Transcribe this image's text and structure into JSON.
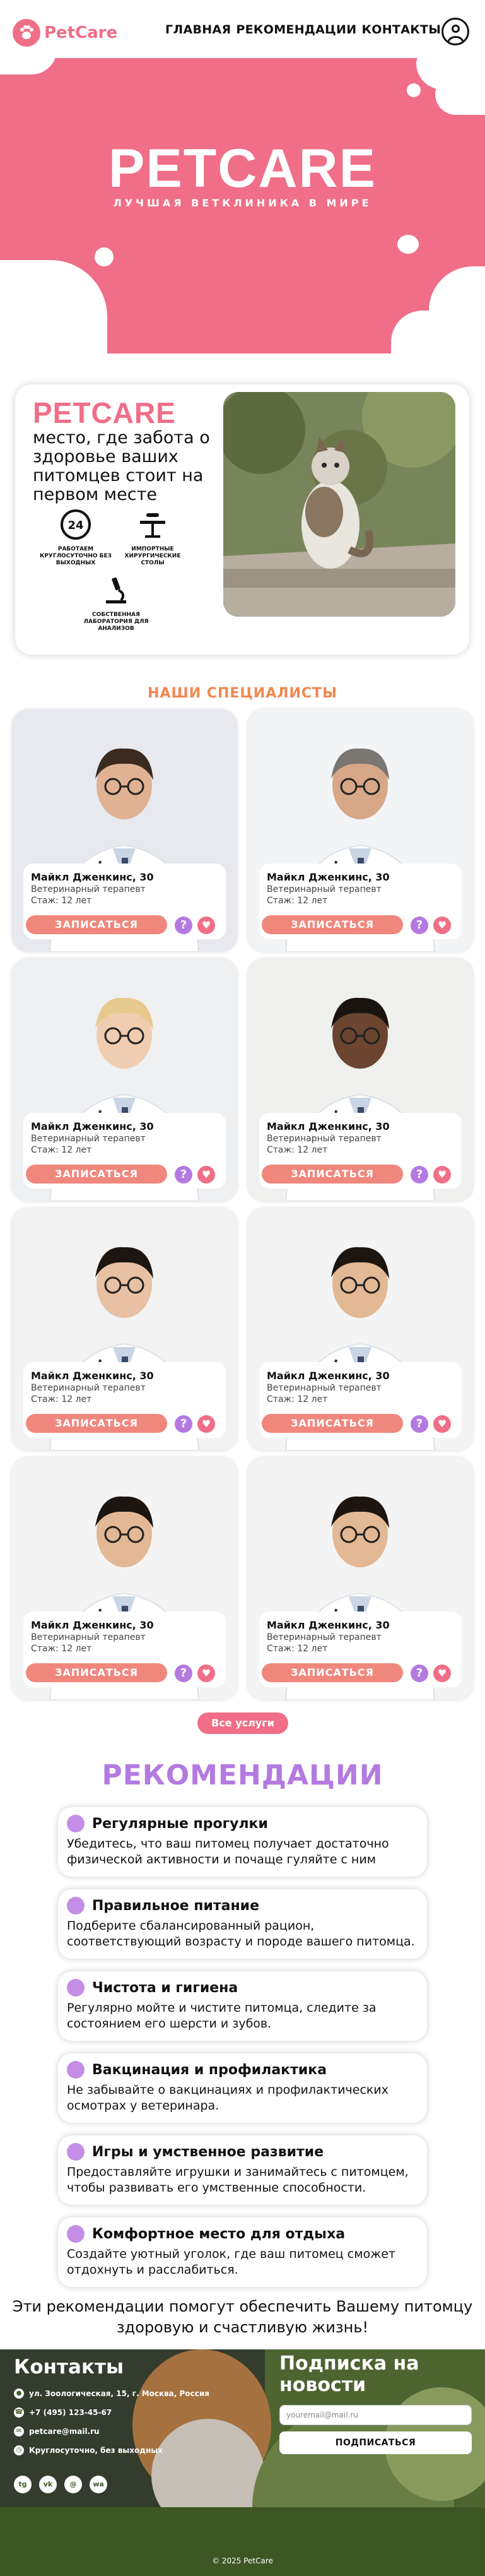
{
  "header": {
    "logo_text": "PetCare",
    "nav": [
      "ГЛАВНАЯ",
      "РЕКОМЕНДАЦИИ",
      "КОНТАКТЫ"
    ]
  },
  "hero": {
    "title": "PETCARE",
    "subtitle": "ЛУЧШАЯ ВЕТКЛИНИКА В МИРЕ"
  },
  "about": {
    "brand": "PETCARE",
    "text": "место, где забота о здоровье ваших питомцев стоит на первом месте",
    "features": [
      {
        "icon": "clock-24-icon",
        "label": "РАБОТАЕМ КРУГЛОСУТОЧНО БЕЗ ВЫХОДНЫХ"
      },
      {
        "icon": "surgical-table-icon",
        "label": "ИМПОРТНЫЕ ХИРУРГИЧЕСКИЕ СТОЛЫ"
      },
      {
        "icon": "microscope-icon",
        "label": "СОБСТВЕННАЯ ЛАБОРАТОРИЯ ДЛЯ АНАЛИЗОВ"
      }
    ]
  },
  "specialists": {
    "title": "НАШИ СПЕЦИАЛИСТЫ",
    "cards": [
      {
        "name": "Майкл Дженкинс, 30",
        "role": "Ветеринарный терапевт",
        "experience": "Стаж: 12 лет",
        "button": "ЗАПИСАТЬСЯ",
        "help": "?",
        "fav": "♥"
      },
      {
        "name": "Майкл Дженкинс, 30",
        "role": "Ветеринарный терапевт",
        "experience": "Стаж: 12 лет",
        "button": "ЗАПИСАТЬСЯ",
        "help": "?",
        "fav": "♥"
      },
      {
        "name": "Майкл Дженкинс, 30",
        "role": "Ветеринарный терапевт",
        "experience": "Стаж: 12 лет",
        "button": "ЗАПИСАТЬСЯ",
        "help": "?",
        "fav": "♥"
      },
      {
        "name": "Майкл Дженкинс, 30",
        "role": "Ветеринарный терапевт",
        "experience": "Стаж: 12 лет",
        "button": "ЗАПИСАТЬСЯ",
        "help": "?",
        "fav": "♥"
      },
      {
        "name": "Майкл Дженкинс, 30",
        "role": "Ветеринарный терапевт",
        "experience": "Стаж: 12 лет",
        "button": "ЗАПИСАТЬСЯ",
        "help": "?",
        "fav": "♥"
      },
      {
        "name": "Майкл Дженкинс, 30",
        "role": "Ветеринарный терапевт",
        "experience": "Стаж: 12 лет",
        "button": "ЗАПИСАТЬСЯ",
        "help": "?",
        "fav": "♥"
      },
      {
        "name": "Майкл Дженкинс, 30",
        "role": "Ветеринарный терапевт",
        "experience": "Стаж: 12 лет",
        "button": "ЗАПИСАТЬСЯ",
        "help": "?",
        "fav": "♥"
      },
      {
        "name": "Майкл Дженкинс, 30",
        "role": "Ветеринарный терапевт",
        "experience": "Стаж: 12 лет",
        "button": "ЗАПИСАТЬСЯ",
        "help": "?",
        "fav": "♥"
      }
    ],
    "all_services": "Все услуги"
  },
  "recommendations": {
    "title": "РЕКОМЕНДАЦИИ",
    "items": [
      {
        "title": "Регулярные прогулки",
        "text": "Убедитесь, что ваш питомец получает достаточно физической активности и почаще гуляйте с ним"
      },
      {
        "title": "Правильное питание",
        "text": "Подберите сбалансированный рацион, соответствующий возрасту и породе вашего питомца."
      },
      {
        "title": "Чистота и гигиена",
        "text": "Регулярно мойте и чистите питомца, следите за состоянием его шерсти и зубов."
      },
      {
        "title": "Вакцинация и профилактика",
        "text": "Не забывайте о вакцинациях и профилактических осмотрах у ветеринара."
      },
      {
        "title": "Игры и умственное развитие",
        "text": "Предоставляйте игрушки и занимайтесь с питомцем, чтобы развивать его умственные способности."
      },
      {
        "title": "Комфортное место для отдыха",
        "text": "Создайте уютный уголок, где ваш питомец сможет отдохнуть и расслабиться."
      }
    ],
    "footer_text": "Эти рекомендации помогут обеспечить Вашему питомцу здоровую и счастливую жизнь!"
  },
  "footer": {
    "contacts_title": "Контакты",
    "address": "ул. Зоологическая, 15, г. Москва, Россия",
    "phone": "+7 (495) 123-45-67",
    "email": "petcare@mail.ru",
    "hours": "Круглосуточно, без выходных",
    "social": [
      "tg",
      "vk",
      "@",
      "wa"
    ],
    "subscribe_title": "Подписка на новости",
    "email_placeholder": "youremail@mail.ru",
    "subscribe_button": "ПОДПИСАТЬСЯ",
    "copyright": "© 2025 PetCare"
  }
}
